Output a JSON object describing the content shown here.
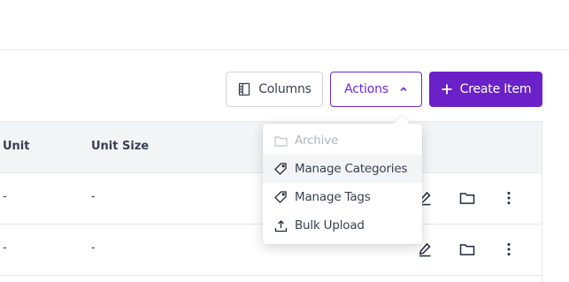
{
  "toolbar": {
    "columns_label": "Columns",
    "actions_label": "Actions",
    "create_label": "Create Item"
  },
  "colors": {
    "accent": "#6b21c8",
    "accent_outline": "#6d28d9",
    "header_bg": "#f3f4f6"
  },
  "table": {
    "headers": [
      "Unit",
      "Unit Size"
    ],
    "rows": [
      {
        "unit": "-",
        "unit_size": "-"
      },
      {
        "unit": "-",
        "unit_size": "-"
      }
    ],
    "row_icons": [
      "edit-icon",
      "folder-icon",
      "more-vertical-icon"
    ]
  },
  "actions_menu": {
    "items": [
      {
        "label": "Archive",
        "icon": "folder-icon",
        "disabled": true
      },
      {
        "label": "Manage Categories",
        "icon": "tag-icon",
        "hovered": true
      },
      {
        "label": "Manage Tags",
        "icon": "tag-icon"
      },
      {
        "label": "Bulk Upload",
        "icon": "upload-icon"
      }
    ]
  }
}
